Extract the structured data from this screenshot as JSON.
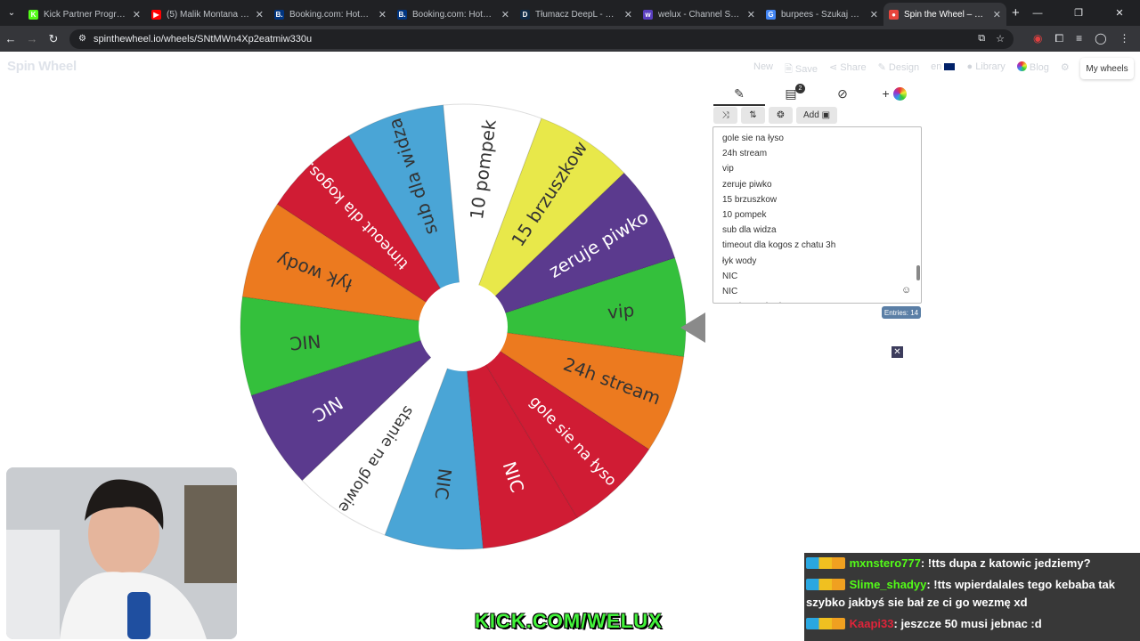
{
  "browser": {
    "tabs": [
      {
        "label": "Kick Partner Program - Ki",
        "color": "#53fc18",
        "glyph": "K"
      },
      {
        "label": "(5) Malik Montana - F",
        "color": "#ff0000",
        "glyph": "▶"
      },
      {
        "label": "Booking.com: Hotele – M",
        "color": "#003580",
        "glyph": "B."
      },
      {
        "label": "Booking.com: Hotele – St",
        "color": "#003580",
        "glyph": "B."
      },
      {
        "label": "Tłumacz DeepL - najlepsz",
        "color": "#0f2b46",
        "glyph": "D"
      },
      {
        "label": "welux - Channel Streams",
        "color": "#5a3fc0",
        "glyph": "w"
      },
      {
        "label": "burpees - Szukaj w Goog",
        "color": "#4285f4",
        "glyph": "G"
      },
      {
        "label": "Spin the Wheel – Free an",
        "color": "#e8453c",
        "glyph": "●"
      }
    ],
    "url": "spinthewheel.io/wheels/SNtMWn4Xp2eatmiw330u"
  },
  "site": {
    "logo": "Spin Wheel",
    "nav": [
      "New",
      "Save",
      "Share",
      "Design",
      "en",
      "Library",
      "Blog"
    ],
    "my_wheels": "My wheels"
  },
  "editor": {
    "add_label": "Add",
    "results_badge": "2",
    "entries": [
      "gole sie na łyso",
      "24h stream",
      "vip",
      "zeruje piwko",
      "15 brzuszkow",
      "10 pompek",
      "sub dla widza",
      "timeout dla kogos z chatu 3h",
      "łyk wody",
      "NIC",
      "NIC",
      "stanie na glowie"
    ],
    "entries_count": "Entries: 14"
  },
  "wheel": {
    "segments": [
      {
        "label": "zeruje piwko",
        "color": "#5b3a8e",
        "text": "#ffffff"
      },
      {
        "label": "15 brzuszkow",
        "color": "#e8e84a",
        "text": "#333333"
      },
      {
        "label": "10 pompek",
        "color": "#ffffff",
        "text": "#333333"
      },
      {
        "label": "sub dla widza",
        "color": "#4aa5d6",
        "text": "#333333"
      },
      {
        "label": "timeout dla kogos...",
        "color": "#d01c34",
        "text": "#ffffff"
      },
      {
        "label": "łyk wody",
        "color": "#ec7a1f",
        "text": "#333333"
      },
      {
        "label": "NIC",
        "color": "#34c03c",
        "text": "#333333"
      },
      {
        "label": "NIC",
        "color": "#5b3a8e",
        "text": "#ffffff"
      },
      {
        "label": "stanie na glowie",
        "color": "#ffffff",
        "text": "#333333"
      },
      {
        "label": "NIC",
        "color": "#4aa5d6",
        "text": "#333333"
      },
      {
        "label": "NIC",
        "color": "#d01c34",
        "text": "#ffffff"
      },
      {
        "label": "gole sie na łyso",
        "color": "#d01c34",
        "text": "#ffffff"
      },
      {
        "label": "24h stream",
        "color": "#ec7a1f",
        "text": "#333333"
      },
      {
        "label": "vip",
        "color": "#34c03c",
        "text": "#333333"
      }
    ]
  },
  "stream": {
    "banner": "KICK.COM/WELUX",
    "chat": [
      {
        "user": "mxnstero777",
        "msg": ": !tts dupa z katowic jedziemy?",
        "user_color": "#53fc18"
      },
      {
        "user": "Slime_shadyy",
        "msg": ": !tts wpierdalales tego kebaba tak szybko jakbyś sie bał ze ci go wezmę xd",
        "user_color": "#53fc18"
      },
      {
        "user": "Kaapi33",
        "msg": ": jeszcze 50 musi jebnac :d",
        "user_color": "#e0243a"
      }
    ]
  }
}
